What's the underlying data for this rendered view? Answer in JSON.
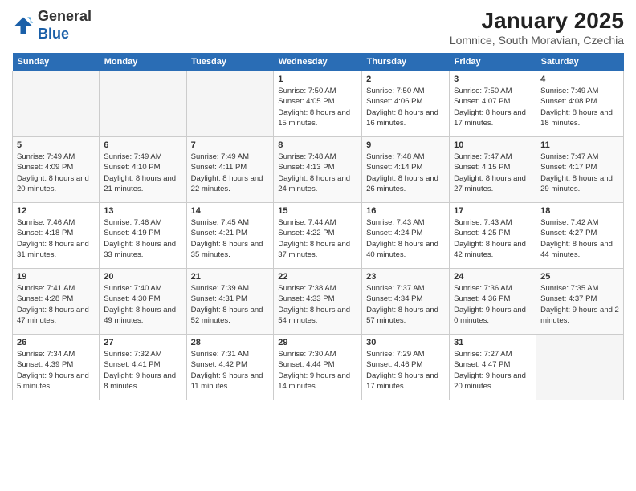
{
  "header": {
    "logo_general": "General",
    "logo_blue": "Blue",
    "month_title": "January 2025",
    "location": "Lomnice, South Moravian, Czechia"
  },
  "days_of_week": [
    "Sunday",
    "Monday",
    "Tuesday",
    "Wednesday",
    "Thursday",
    "Friday",
    "Saturday"
  ],
  "weeks": [
    [
      {
        "day": "",
        "info": ""
      },
      {
        "day": "",
        "info": ""
      },
      {
        "day": "",
        "info": ""
      },
      {
        "day": "1",
        "info": "Sunrise: 7:50 AM\nSunset: 4:05 PM\nDaylight: 8 hours\nand 15 minutes."
      },
      {
        "day": "2",
        "info": "Sunrise: 7:50 AM\nSunset: 4:06 PM\nDaylight: 8 hours\nand 16 minutes."
      },
      {
        "day": "3",
        "info": "Sunrise: 7:50 AM\nSunset: 4:07 PM\nDaylight: 8 hours\nand 17 minutes."
      },
      {
        "day": "4",
        "info": "Sunrise: 7:49 AM\nSunset: 4:08 PM\nDaylight: 8 hours\nand 18 minutes."
      }
    ],
    [
      {
        "day": "5",
        "info": "Sunrise: 7:49 AM\nSunset: 4:09 PM\nDaylight: 8 hours\nand 20 minutes."
      },
      {
        "day": "6",
        "info": "Sunrise: 7:49 AM\nSunset: 4:10 PM\nDaylight: 8 hours\nand 21 minutes."
      },
      {
        "day": "7",
        "info": "Sunrise: 7:49 AM\nSunset: 4:11 PM\nDaylight: 8 hours\nand 22 minutes."
      },
      {
        "day": "8",
        "info": "Sunrise: 7:48 AM\nSunset: 4:13 PM\nDaylight: 8 hours\nand 24 minutes."
      },
      {
        "day": "9",
        "info": "Sunrise: 7:48 AM\nSunset: 4:14 PM\nDaylight: 8 hours\nand 26 minutes."
      },
      {
        "day": "10",
        "info": "Sunrise: 7:47 AM\nSunset: 4:15 PM\nDaylight: 8 hours\nand 27 minutes."
      },
      {
        "day": "11",
        "info": "Sunrise: 7:47 AM\nSunset: 4:17 PM\nDaylight: 8 hours\nand 29 minutes."
      }
    ],
    [
      {
        "day": "12",
        "info": "Sunrise: 7:46 AM\nSunset: 4:18 PM\nDaylight: 8 hours\nand 31 minutes."
      },
      {
        "day": "13",
        "info": "Sunrise: 7:46 AM\nSunset: 4:19 PM\nDaylight: 8 hours\nand 33 minutes."
      },
      {
        "day": "14",
        "info": "Sunrise: 7:45 AM\nSunset: 4:21 PM\nDaylight: 8 hours\nand 35 minutes."
      },
      {
        "day": "15",
        "info": "Sunrise: 7:44 AM\nSunset: 4:22 PM\nDaylight: 8 hours\nand 37 minutes."
      },
      {
        "day": "16",
        "info": "Sunrise: 7:43 AM\nSunset: 4:24 PM\nDaylight: 8 hours\nand 40 minutes."
      },
      {
        "day": "17",
        "info": "Sunrise: 7:43 AM\nSunset: 4:25 PM\nDaylight: 8 hours\nand 42 minutes."
      },
      {
        "day": "18",
        "info": "Sunrise: 7:42 AM\nSunset: 4:27 PM\nDaylight: 8 hours\nand 44 minutes."
      }
    ],
    [
      {
        "day": "19",
        "info": "Sunrise: 7:41 AM\nSunset: 4:28 PM\nDaylight: 8 hours\nand 47 minutes."
      },
      {
        "day": "20",
        "info": "Sunrise: 7:40 AM\nSunset: 4:30 PM\nDaylight: 8 hours\nand 49 minutes."
      },
      {
        "day": "21",
        "info": "Sunrise: 7:39 AM\nSunset: 4:31 PM\nDaylight: 8 hours\nand 52 minutes."
      },
      {
        "day": "22",
        "info": "Sunrise: 7:38 AM\nSunset: 4:33 PM\nDaylight: 8 hours\nand 54 minutes."
      },
      {
        "day": "23",
        "info": "Sunrise: 7:37 AM\nSunset: 4:34 PM\nDaylight: 8 hours\nand 57 minutes."
      },
      {
        "day": "24",
        "info": "Sunrise: 7:36 AM\nSunset: 4:36 PM\nDaylight: 9 hours\nand 0 minutes."
      },
      {
        "day": "25",
        "info": "Sunrise: 7:35 AM\nSunset: 4:37 PM\nDaylight: 9 hours\nand 2 minutes."
      }
    ],
    [
      {
        "day": "26",
        "info": "Sunrise: 7:34 AM\nSunset: 4:39 PM\nDaylight: 9 hours\nand 5 minutes."
      },
      {
        "day": "27",
        "info": "Sunrise: 7:32 AM\nSunset: 4:41 PM\nDaylight: 9 hours\nand 8 minutes."
      },
      {
        "day": "28",
        "info": "Sunrise: 7:31 AM\nSunset: 4:42 PM\nDaylight: 9 hours\nand 11 minutes."
      },
      {
        "day": "29",
        "info": "Sunrise: 7:30 AM\nSunset: 4:44 PM\nDaylight: 9 hours\nand 14 minutes."
      },
      {
        "day": "30",
        "info": "Sunrise: 7:29 AM\nSunset: 4:46 PM\nDaylight: 9 hours\nand 17 minutes."
      },
      {
        "day": "31",
        "info": "Sunrise: 7:27 AM\nSunset: 4:47 PM\nDaylight: 9 hours\nand 20 minutes."
      },
      {
        "day": "",
        "info": ""
      }
    ]
  ]
}
